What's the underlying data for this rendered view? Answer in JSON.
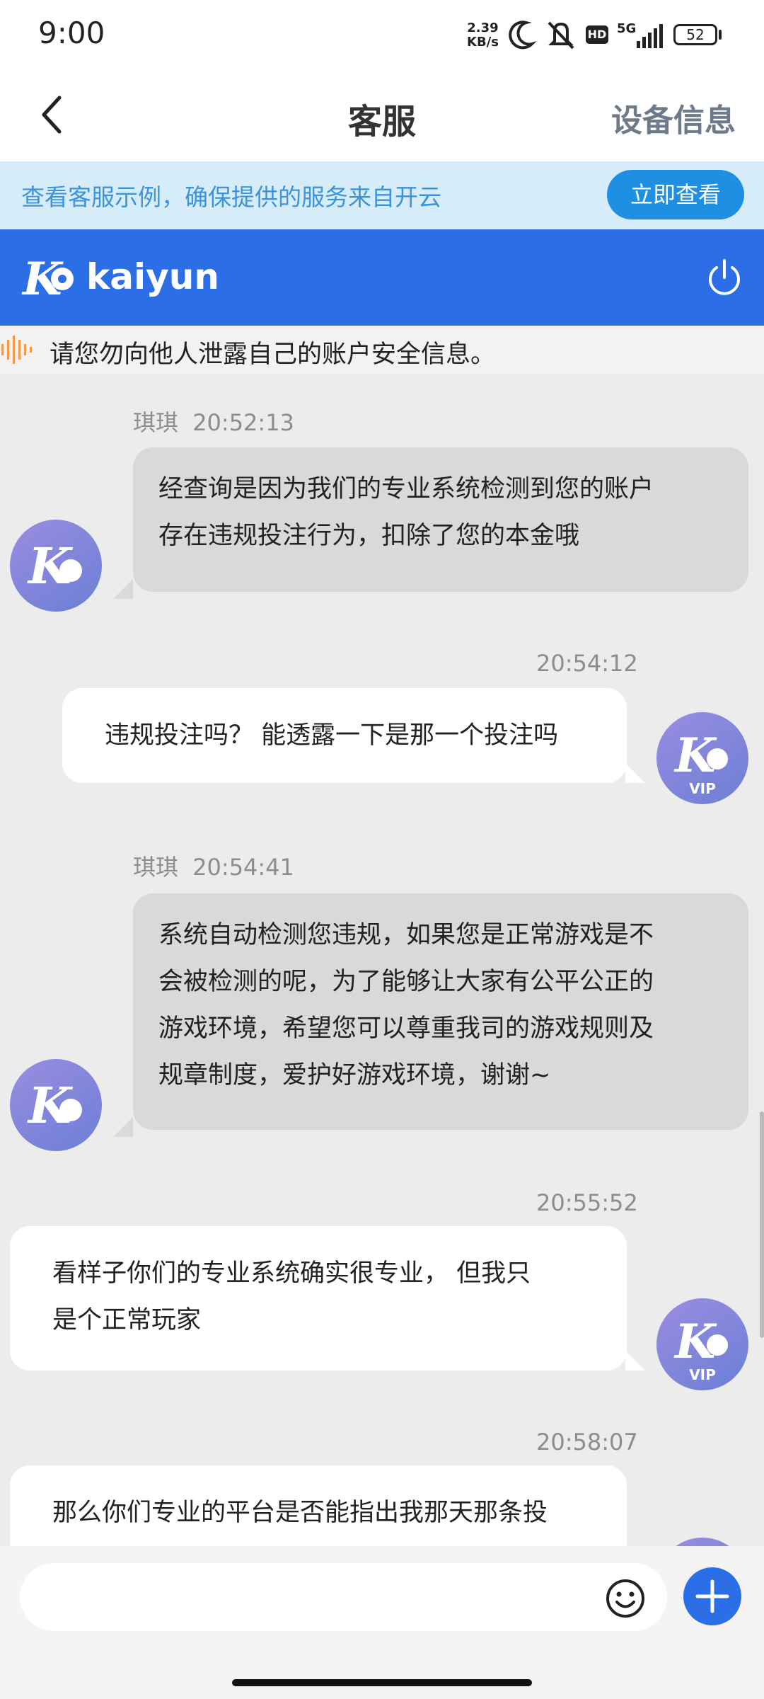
{
  "status_bar": {
    "time": "9:00",
    "net_speed_value": "2.39",
    "net_speed_unit": "KB/s",
    "network": "5G",
    "battery": "52",
    "icons": [
      "moon-icon",
      "mute-icon",
      "hd-icon",
      "signal-icon",
      "battery-icon"
    ]
  },
  "header": {
    "title": "客服",
    "right_action": "设备信息"
  },
  "tip_banner": {
    "text": "查看客服示例，确保提供的服务来自开云",
    "button": "立即查看"
  },
  "brand": {
    "name": "kaiyun"
  },
  "notice": {
    "text": "请您勿向他人泄露自己的账户安全信息。"
  },
  "messages": [
    {
      "sender": "agent",
      "name": "琪琪",
      "time": "20:52:13",
      "lines": [
        "经查询是因为我们的专业系统检测到您的账户",
        "存在违规投注行为，扣除了您的本金哦"
      ]
    },
    {
      "sender": "user",
      "time": "20:54:12",
      "lines": [
        "违规投注吗？ 能透露一下是那一个投注吗"
      ],
      "badge": "VIP"
    },
    {
      "sender": "agent",
      "name": "琪琪",
      "time": "20:54:41",
      "lines": [
        "系统自动检测您违规，如果您是正常游戏是不",
        "会被检测的呢，为了能够让大家有公平公正的",
        "游戏环境，希望您可以尊重我司的游戏规则及",
        "规章制度，爱护好游戏环境，谢谢~"
      ]
    },
    {
      "sender": "user",
      "time": "20:55:52",
      "lines": [
        "看样子你们的专业系统确实很专业， 但我只",
        "是个正常玩家"
      ],
      "badge": "VIP"
    },
    {
      "sender": "user",
      "time": "20:58:07",
      "lines": [
        "那么你们专业的平台是否能指出我那天那条投"
      ]
    }
  ],
  "input": {
    "placeholder": ""
  },
  "colors": {
    "brand_blue": "#2c6ee6",
    "tip_bg": "#d6edf9",
    "tip_text": "#3b93dc",
    "chat_bg": "#ececec",
    "agent_bubble": "#d9d9d9",
    "user_bubble": "#ffffff"
  }
}
